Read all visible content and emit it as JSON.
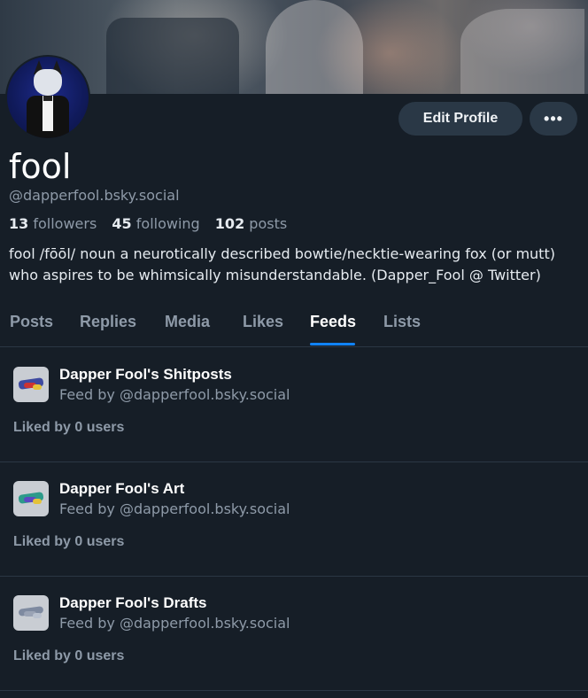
{
  "profile": {
    "display_name": "fool",
    "handle": "@dapperfool.bsky.social",
    "followers_count": "13",
    "followers_label": "followers",
    "following_count": "45",
    "following_label": "following",
    "posts_count": "102",
    "posts_label": "posts",
    "bio": "fool /fōōl/ noun a neurotically described bowtie/necktie-wearing fox (or mutt) who aspires to be whimsically misunderstandable. (Dapper_Fool @ Twitter)"
  },
  "actions": {
    "edit_profile": "Edit Profile",
    "more": "•••"
  },
  "tabs": [
    {
      "label": "Posts"
    },
    {
      "label": "Replies"
    },
    {
      "label": "Media"
    },
    {
      "label": "Likes"
    },
    {
      "label": "Feeds",
      "active": true
    },
    {
      "label": "Lists"
    }
  ],
  "feeds": [
    {
      "title": "Dapper Fool's Shitposts",
      "subtitle": "Feed by @dapperfool.bsky.social",
      "likes": "Liked by 0 users"
    },
    {
      "title": "Dapper Fool's Art",
      "subtitle": "Feed by @dapperfool.bsky.social",
      "likes": "Liked by 0 users"
    },
    {
      "title": "Dapper Fool's Drafts",
      "subtitle": "Feed by @dapperfool.bsky.social",
      "likes": "Liked by 0 users"
    }
  ],
  "colors": {
    "background": "#161e27",
    "accent": "#1083fe",
    "muted_text": "#8e9aa8",
    "button_bg": "#2a3846"
  }
}
